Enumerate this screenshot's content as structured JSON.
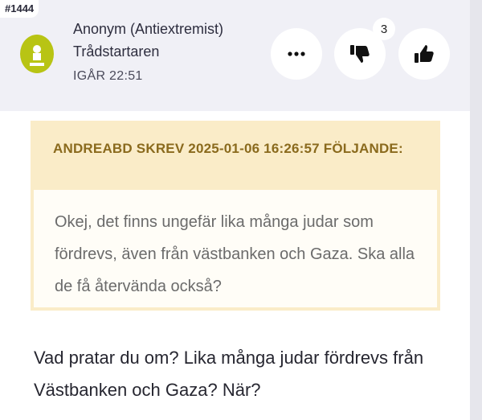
{
  "post": {
    "number": "#1444",
    "author": "Anonym (Antiextremist)",
    "role": "Trådstartaren",
    "time": "IGÅR 22:51",
    "dislike_count": "3"
  },
  "quote": {
    "header": "ANDREABD SKREV 2025-01-06 16:26:57 FÖLJANDE:",
    "text": "Okej, det finns ungefär lika många judar som fördrevs, även från västbanken och Gaza. Ska alla de få återvända också?"
  },
  "reply": {
    "text": "Vad pratar du om? Lika många judar fördrevs från Västbanken och Gaza? När?"
  },
  "colors": {
    "header_bg": "#f0f0f6",
    "avatar": "#b8c414",
    "quote_header_bg": "#faecc8",
    "quote_header_text": "#8a6a1d"
  },
  "icons": {
    "more": "more-dots-icon",
    "dislike": "thumbs-down-icon",
    "like": "thumbs-up-icon",
    "avatar": "user-avatar-icon"
  }
}
